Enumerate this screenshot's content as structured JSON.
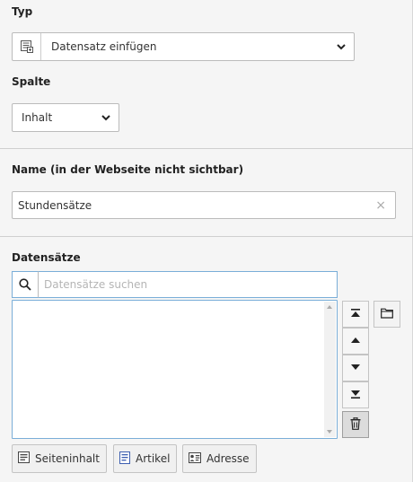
{
  "typ": {
    "label": "Typ",
    "selected": "Datensatz einfügen"
  },
  "spalte": {
    "label": "Spalte",
    "selected": "Inhalt"
  },
  "name": {
    "label": "Name (in der Webseite nicht sichtbar)",
    "value": "Stundensätze",
    "clear": "×"
  },
  "datensaetze": {
    "label": "Datensätze",
    "search_placeholder": "Datensätze suchen",
    "buttons": [
      "Seiteninhalt",
      "Artikel",
      "Adresse"
    ]
  },
  "icons": {
    "type": "record-insert-icon",
    "search": "search-icon",
    "folder": "folder-icon",
    "top": "move-top-icon",
    "up": "move-up-icon",
    "down": "move-down-icon",
    "bottom": "move-bottom-icon",
    "delete": "trash-icon"
  }
}
